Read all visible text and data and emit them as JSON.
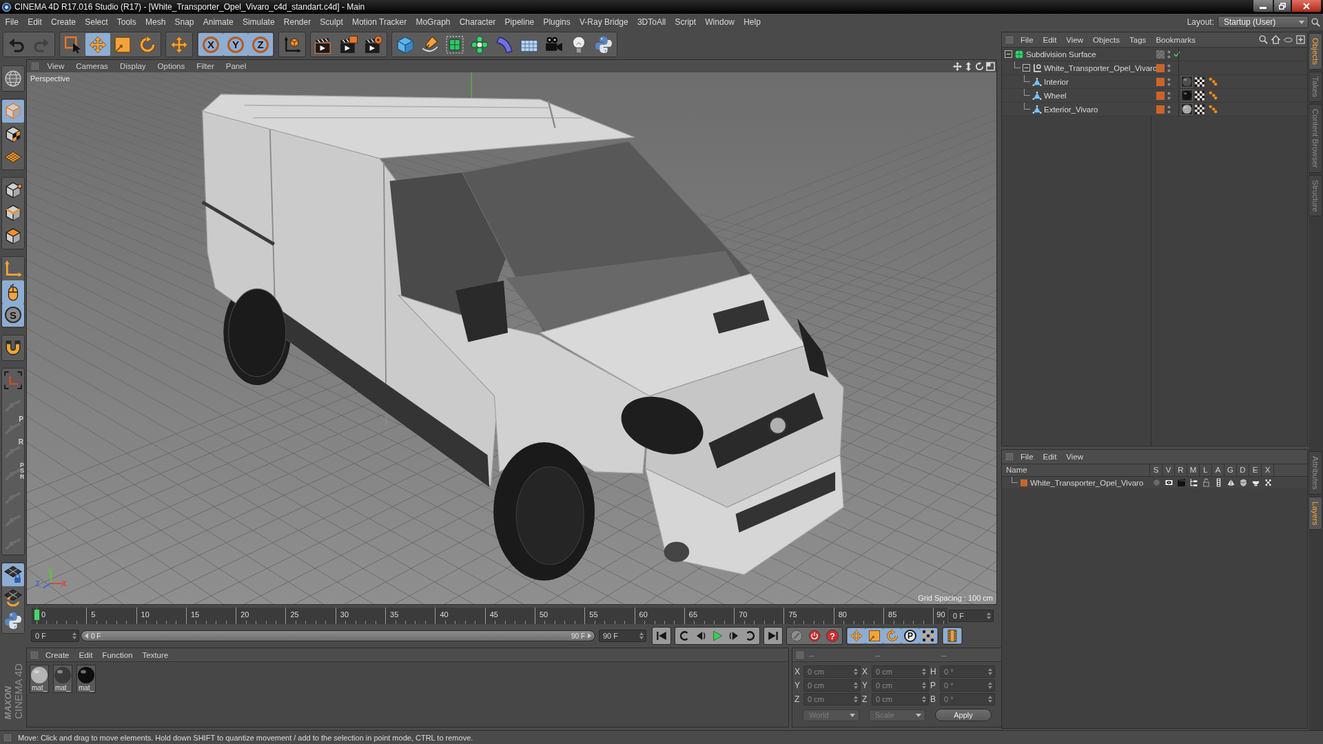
{
  "window": {
    "title": "CINEMA 4D R17.016 Studio (R17) - [White_Transporter_Opel_Vivaro_c4d_standart.c4d] - Main"
  },
  "menu_bar": [
    "File",
    "Edit",
    "Create",
    "Select",
    "Tools",
    "Mesh",
    "Snap",
    "Animate",
    "Simulate",
    "Render",
    "Sculpt",
    "Motion Tracker",
    "MoGraph",
    "Character",
    "Pipeline",
    "Plugins",
    "V-Ray Bridge",
    "3DToAll",
    "Script",
    "Window",
    "Help"
  ],
  "layout": {
    "label": "Layout:",
    "value": "Startup (User)"
  },
  "toolbar": [
    [
      {
        "kind": "undo",
        "selected": false,
        "disabled": false
      },
      {
        "kind": "redo",
        "selected": false,
        "disabled": true
      }
    ],
    [
      {
        "kind": "select",
        "selected": false,
        "disabled": false
      },
      {
        "kind": "move",
        "selected": true,
        "disabled": false
      },
      {
        "kind": "scale",
        "selected": false,
        "disabled": false
      },
      {
        "kind": "rotate",
        "selected": false,
        "disabled": false
      }
    ],
    [
      {
        "kind": "recent",
        "selected": false,
        "disabled": false
      }
    ],
    [
      {
        "kind": "axis",
        "label": "X",
        "selected": true,
        "disabled": false
      },
      {
        "kind": "axis",
        "label": "Y",
        "selected": true,
        "disabled": false
      },
      {
        "kind": "axis",
        "label": "Z",
        "selected": true,
        "disabled": false
      }
    ],
    [
      {
        "kind": "coords",
        "selected": false,
        "disabled": false
      }
    ],
    [
      {
        "kind": "renderview",
        "selected": false,
        "disabled": false
      },
      {
        "kind": "renderpv",
        "selected": false,
        "disabled": false
      },
      {
        "kind": "rendersettings",
        "selected": false,
        "disabled": false
      }
    ],
    [
      {
        "kind": "cube",
        "selected": false,
        "disabled": false
      },
      {
        "kind": "pen",
        "selected": false,
        "disabled": false
      },
      {
        "kind": "subdiv",
        "selected": false,
        "disabled": false
      },
      {
        "kind": "cloner",
        "selected": false,
        "disabled": false
      },
      {
        "kind": "bend",
        "selected": false,
        "disabled": false
      },
      {
        "kind": "floor",
        "selected": false,
        "disabled": false
      },
      {
        "kind": "camera",
        "selected": false,
        "disabled": false
      },
      {
        "kind": "light",
        "selected": false,
        "disabled": false
      },
      {
        "kind": "python",
        "selected": false,
        "disabled": false
      }
    ]
  ],
  "left_toolbar": [
    [
      {
        "kind": "editable",
        "selected": false,
        "disabled": false
      }
    ],
    [
      {
        "kind": "model",
        "selected": true,
        "disabled": false
      },
      {
        "kind": "texture",
        "selected": false,
        "disabled": false
      },
      {
        "kind": "workplane",
        "selected": false,
        "disabled": false
      }
    ],
    [
      {
        "kind": "points",
        "selected": false,
        "disabled": false
      },
      {
        "kind": "edges",
        "selected": false,
        "disabled": false
      },
      {
        "kind": "polygons",
        "selected": false,
        "disabled": false
      }
    ],
    [
      {
        "kind": "axismode",
        "selected": false,
        "disabled": false
      },
      {
        "kind": "tweak",
        "selected": true,
        "disabled": false
      },
      {
        "kind": "solo",
        "label": "S",
        "selected": true,
        "disabled": false
      }
    ],
    [
      {
        "kind": "snap",
        "selected": false,
        "disabled": false
      }
    ],
    [
      {
        "kind": "enableaxis",
        "selected": false,
        "disabled": false
      },
      {
        "kind": "joint",
        "selected": false,
        "disabled": true
      },
      {
        "kind": "joint",
        "label": "P",
        "selected": false,
        "disabled": true
      },
      {
        "kind": "joint",
        "label": "R",
        "selected": false,
        "disabled": true
      },
      {
        "kind": "joint",
        "label": "PSR",
        "selected": false,
        "disabled": true
      },
      {
        "kind": "joint",
        "selected": false,
        "disabled": true
      },
      {
        "kind": "joint",
        "selected": false,
        "disabled": true
      },
      {
        "kind": "joint",
        "selected": false,
        "disabled": true
      }
    ],
    [
      {
        "kind": "lockplane",
        "selected": true,
        "disabled": false
      },
      {
        "kind": "planerotate",
        "selected": false,
        "disabled": false
      },
      {
        "kind": "python",
        "selected": false,
        "disabled": false
      }
    ]
  ],
  "logo": [
    "MAXON",
    "CINEMA 4D"
  ],
  "viewport": {
    "menu": [
      "View",
      "Cameras",
      "Display",
      "Options",
      "Filter",
      "Panel"
    ],
    "camera": "Perspective",
    "axis_labels": [
      {
        "label": "Y",
        "color": "#5ec43c"
      },
      {
        "label": "Z",
        "color": "#4468d0"
      },
      {
        "label": "X",
        "color": "#d4483c"
      }
    ],
    "grid_spacing": "Grid Spacing : 100 cm"
  },
  "timeline": {
    "ruler": [
      "0",
      "5",
      "10",
      "15",
      "20",
      "25",
      "30",
      "35",
      "40",
      "45",
      "50",
      "55",
      "60",
      "65",
      "70",
      "75",
      "80",
      "85",
      "90"
    ],
    "level": 0,
    "current_frame": "0 F",
    "start": "0 F",
    "range": {
      "start": "0 F",
      "end": "90 F",
      "level": 1
    },
    "end": "90 F",
    "transport": [
      [
        {
          "kind": "first"
        }
      ],
      [
        {
          "kind": "rewind"
        },
        {
          "kind": "prevframe"
        },
        {
          "kind": "play"
        },
        {
          "kind": "nextframe"
        },
        {
          "kind": "loop"
        }
      ],
      [
        {
          "kind": "last"
        }
      ]
    ],
    "record": [
      {
        "kind": "record",
        "selected": false
      },
      {
        "kind": "autokey",
        "selected": false
      },
      {
        "kind": "keyhelp",
        "label": "?",
        "selected": false
      }
    ],
    "key_tracks": [
      {
        "kind": "movekey",
        "selected": true
      },
      {
        "kind": "scalekey",
        "selected": true
      },
      {
        "kind": "rotatekey",
        "selected": true
      },
      {
        "kind": "param",
        "label": "P",
        "selected": true
      },
      {
        "kind": "dotsgrid",
        "selected": true
      }
    ],
    "view_button": {
      "kind": "film",
      "selected": true
    }
  },
  "materials": {
    "menu": [
      "Create",
      "Edit",
      "Function",
      "Texture"
    ],
    "items": [
      {
        "name": "mat_",
        "color": "#b4b4b4"
      },
      {
        "name": "mat_",
        "color": "#3a3a3a"
      },
      {
        "name": "mat_",
        "color": "#0e0e0e"
      }
    ]
  },
  "coordinates": {
    "headers": [
      "--",
      "--",
      "--"
    ],
    "rows": [
      {
        "position_axis": "X",
        "position": "0 cm",
        "size_axis": "X",
        "size": "0 cm",
        "rotation_axis": "H",
        "rotation": "0 °"
      },
      {
        "position_axis": "Y",
        "position": "0 cm",
        "size_axis": "Y",
        "size": "0 cm",
        "rotation_axis": "P",
        "rotation": "0 °"
      },
      {
        "position_axis": "Z",
        "position": "0 cm",
        "size_axis": "Z",
        "size": "0 cm",
        "rotation_axis": "B",
        "rotation": "0 °"
      }
    ],
    "dropdowns": [
      {
        "value": "World",
        "disabled": true
      },
      {
        "value": "Scale",
        "disabled": true
      }
    ],
    "apply": "Apply"
  },
  "objects": {
    "menu": [
      "File",
      "Edit",
      "View",
      "Objects",
      "Tags",
      "Bookmarks"
    ],
    "tree": [
      {
        "kind": "subdivision",
        "name": "Subdivision Surface",
        "expanded": true,
        "enabled": true,
        "children": [
          {
            "kind": "null",
            "name": "White_Transporter_Opel_Vivaro",
            "color": "#c9652b",
            "expanded": true,
            "children": [
              {
                "kind": "polygon",
                "name": "Interior",
                "color": "#c9652b",
                "tags": [
                  {
                    "kind": "material",
                    "color": "#4e4e4e"
                  },
                  {
                    "kind": "uvw"
                  },
                  {
                    "kind": "selection"
                  }
                ]
              },
              {
                "kind": "polygon",
                "name": "Wheel",
                "color": "#c9652b",
                "tags": [
                  {
                    "kind": "material",
                    "color": "#111111"
                  },
                  {
                    "kind": "uvw"
                  },
                  {
                    "kind": "selection"
                  }
                ]
              },
              {
                "kind": "polygon",
                "name": "Exterior_Vivaro",
                "color": "#c9652b",
                "tags": [
                  {
                    "kind": "material",
                    "color": "#a8a8a8"
                  },
                  {
                    "kind": "uvw"
                  },
                  {
                    "kind": "selection"
                  }
                ]
              }
            ]
          }
        ]
      }
    ]
  },
  "layers": {
    "menu": [
      "File",
      "Edit",
      "View"
    ],
    "columns": [
      "Name",
      "S",
      "V",
      "R",
      "M",
      "L",
      "A",
      "G",
      "D",
      "E",
      "X"
    ],
    "rows": [
      {
        "name": "White_Transporter_Opel_Vivaro",
        "color": "#c9652b",
        "flags": [
          {
            "kind": "solo",
            "on": false
          },
          {
            "kind": "view",
            "on": true
          },
          {
            "kind": "render",
            "on": true
          },
          {
            "kind": "manager",
            "on": true
          },
          {
            "kind": "lock",
            "on": false
          },
          {
            "kind": "animation",
            "on": true
          },
          {
            "kind": "generators",
            "on": true
          },
          {
            "kind": "deformers",
            "on": true
          },
          {
            "kind": "expressions",
            "on": true
          },
          {
            "kind": "xref",
            "on": true
          }
        ]
      }
    ]
  },
  "side_tabs": {
    "top": [
      {
        "label": "Objects",
        "selected": true
      },
      {
        "label": "Takes",
        "selected": false
      },
      {
        "label": "Content Browser",
        "selected": false
      },
      {
        "label": "Structure",
        "selected": false
      }
    ],
    "bottom": [
      {
        "label": "Attributes",
        "selected": false
      },
      {
        "label": "Layers",
        "selected": true
      }
    ]
  },
  "status_bar": "Move: Click and drag to move elements. Hold down SHIFT to quantize movement / add to the selection in point mode, CTRL to remove."
}
